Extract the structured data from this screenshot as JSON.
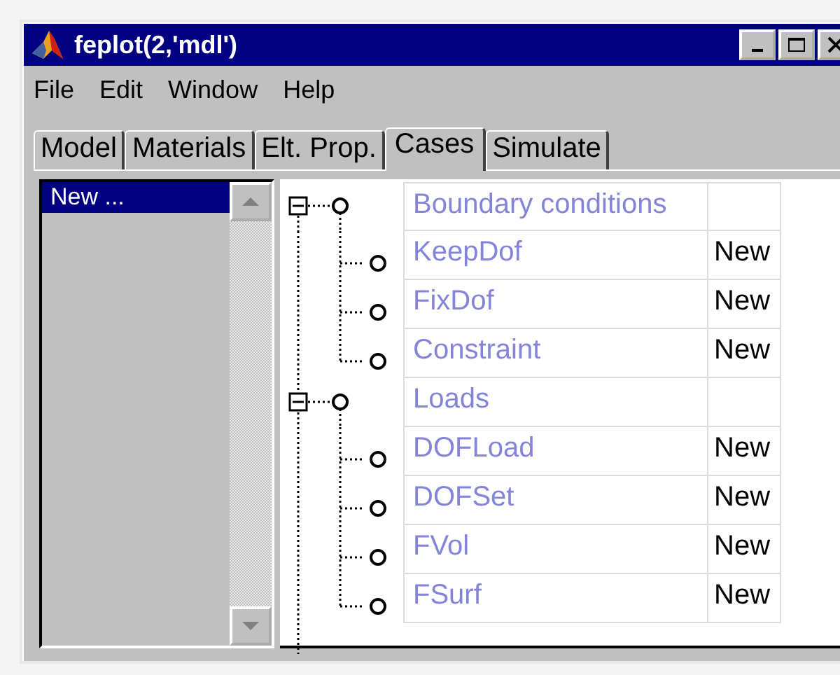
{
  "window": {
    "title": "feplot(2,'mdl')"
  },
  "menu": [
    "File",
    "Edit",
    "Window",
    "Help"
  ],
  "tabs": [
    {
      "label": "Model",
      "selected": false
    },
    {
      "label": "Materials",
      "selected": false
    },
    {
      "label": "Elt. Prop.",
      "selected": false
    },
    {
      "label": "Cases",
      "selected": true
    },
    {
      "label": "Simulate",
      "selected": false
    }
  ],
  "case_list": {
    "items": [
      {
        "label": "New ...",
        "selected": true
      }
    ]
  },
  "tree": [
    {
      "label": "Boundary conditions",
      "expanded": true,
      "children": [
        {
          "label": "KeepDof",
          "value": "New"
        },
        {
          "label": "FixDof",
          "value": "New"
        },
        {
          "label": "Constraint",
          "value": "New"
        }
      ]
    },
    {
      "label": "Loads",
      "expanded": true,
      "children": [
        {
          "label": "DOFLoad",
          "value": "New"
        },
        {
          "label": "DOFSet",
          "value": "New"
        },
        {
          "label": "FVol",
          "value": "New"
        },
        {
          "label": "FSurf",
          "value": "New"
        }
      ]
    }
  ]
}
